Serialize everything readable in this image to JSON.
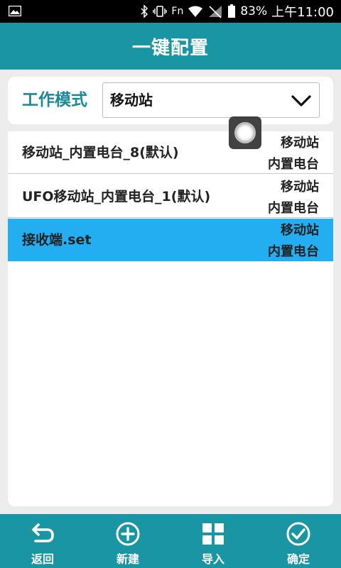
{
  "status_bar": {
    "battery": "83%",
    "time": "上午11:00",
    "fn": "Fn",
    "icons": [
      "image-icon",
      "bluetooth-icon",
      "vibrate-icon",
      "wifi-icon",
      "no-signal-icon",
      "battery-icon"
    ]
  },
  "header": {
    "title": "一键配置"
  },
  "work_mode": {
    "label": "工作模式",
    "selected": "移动站"
  },
  "list": [
    {
      "name": "移动站_内置电台_8(默认)",
      "meta_line1": "移动站",
      "meta_line2": "内置电台",
      "selected": false
    },
    {
      "name": "UFO移动站_内置电台_1(默认)",
      "meta_line1": "移动站",
      "meta_line2": "内置电台",
      "selected": false
    },
    {
      "name": "接收端.set",
      "meta_line1": "移动站",
      "meta_line2": "内置电台",
      "selected": true
    }
  ],
  "bottom_nav": {
    "back": "返回",
    "new": "新建",
    "import": "导入",
    "confirm": "确定"
  },
  "colors": {
    "primary": "#1a95a3",
    "selected_row": "#23aef2",
    "label": "#1a8a98"
  }
}
